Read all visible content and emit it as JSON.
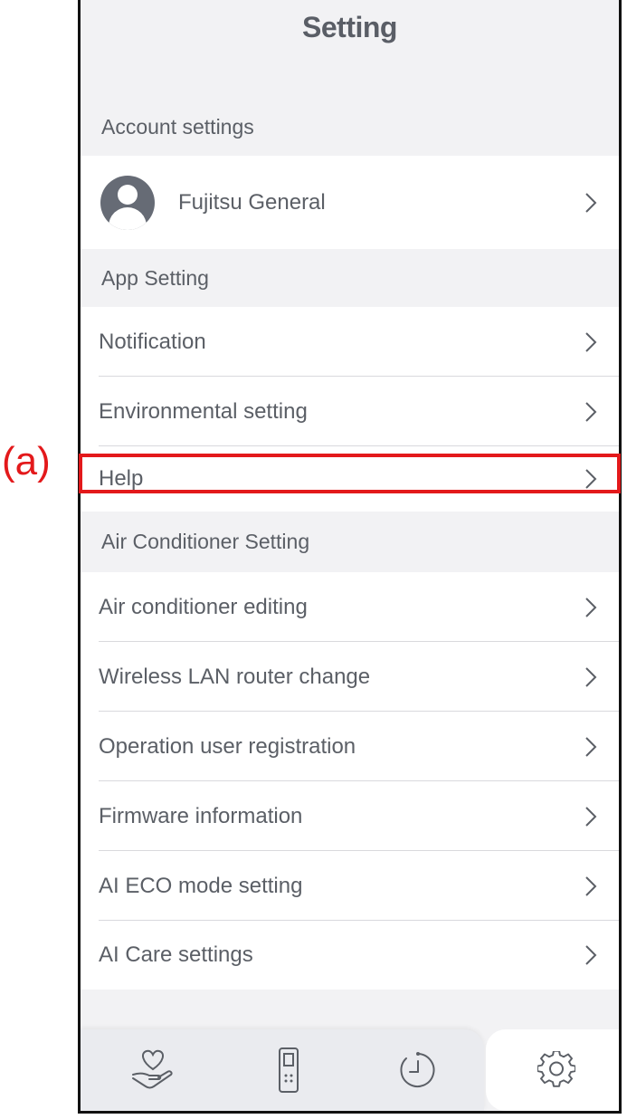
{
  "callout": {
    "label": "(a)"
  },
  "header": {
    "title": "Setting"
  },
  "sections": {
    "account": {
      "label": "Account settings",
      "user_name": "Fujitsu General"
    },
    "app": {
      "label": "App Setting",
      "items": [
        {
          "label": "Notification"
        },
        {
          "label": "Environmental setting"
        },
        {
          "label": "Help"
        }
      ]
    },
    "air_conditioner": {
      "label": "Air Conditioner Setting",
      "items": [
        {
          "label": "Air conditioner editing"
        },
        {
          "label": "Wireless LAN router change"
        },
        {
          "label": "Operation user registration"
        },
        {
          "label": "Firmware information"
        },
        {
          "label": "AI ECO mode setting"
        },
        {
          "label": "AI Care settings"
        }
      ]
    }
  },
  "tabbar": {
    "tabs": [
      {
        "icon": "heart-hand-icon"
      },
      {
        "icon": "remote-control-icon"
      },
      {
        "icon": "timer-icon"
      },
      {
        "icon": "gear-icon",
        "active": true
      }
    ]
  },
  "colors": {
    "highlight": "#e3191b",
    "text": "#5b5f66",
    "background": "#f2f2f4"
  }
}
